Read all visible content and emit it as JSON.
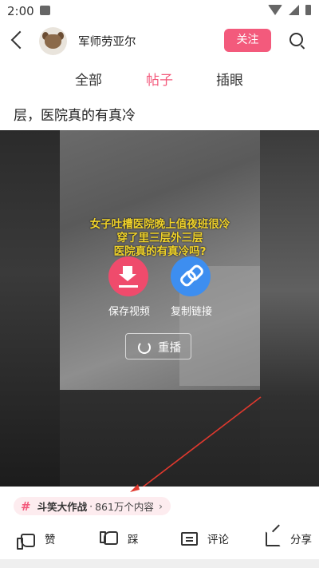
{
  "status_bar": {
    "time": "2:00"
  },
  "header": {
    "user_name": "军师劳亚尔",
    "follow_label": "关注"
  },
  "tabs": [
    {
      "label": "全部",
      "active": false
    },
    {
      "label": "帖子",
      "active": true
    },
    {
      "label": "插眼",
      "active": false
    }
  ],
  "post": {
    "title": "层，医院真的有真冷"
  },
  "video": {
    "caption_lines": [
      "女子吐槽医院晚上值夜班很冷",
      "穿了里三层外三层",
      "医院真的有真冷吗?"
    ],
    "save_label": "保存视频",
    "copy_label": "复制链接",
    "replay_label": "重播"
  },
  "tag": {
    "name": "斗笑大作战",
    "separator": "·",
    "count": "861万个内容",
    "chevron": "›"
  },
  "actions": {
    "like_label": "赞",
    "dislike_label": "踩",
    "comment_label": "评论",
    "share_label": "分享"
  },
  "colors": {
    "accent": "#f35a7c",
    "save_button": "#ef4b6c",
    "copy_button": "#3d8ef0",
    "caption": "#f0d22a"
  },
  "icons": [
    "back-icon",
    "search-icon",
    "download-icon",
    "link-icon",
    "replay-icon",
    "hash-icon",
    "thumbs-up-icon",
    "thumbs-down-icon",
    "comment-icon",
    "share-icon"
  ]
}
